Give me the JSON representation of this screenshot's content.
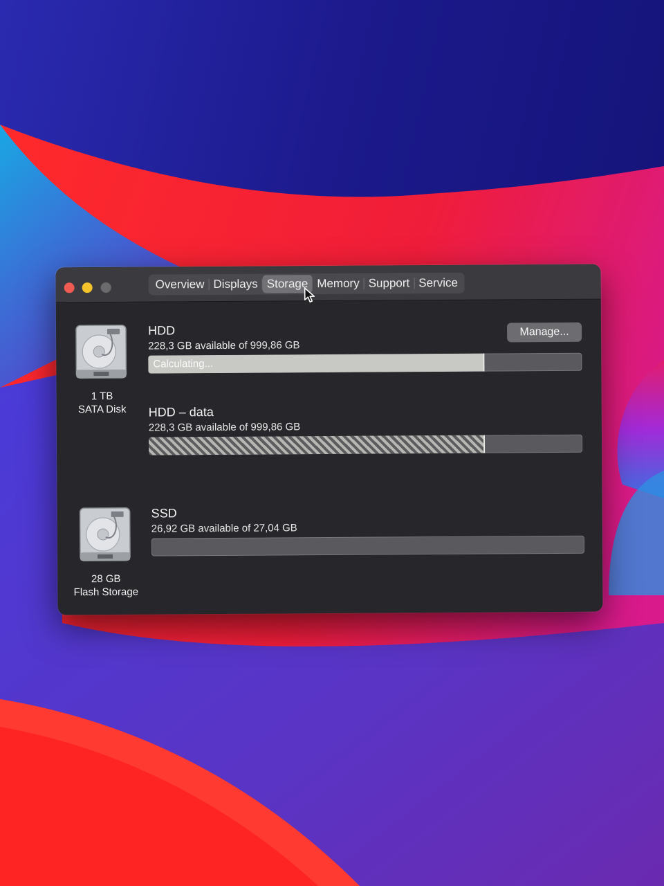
{
  "window": {
    "tabs": [
      {
        "label": "Overview"
      },
      {
        "label": "Displays"
      },
      {
        "label": "Storage",
        "selected": true
      },
      {
        "label": "Memory"
      },
      {
        "label": "Support"
      },
      {
        "label": "Service"
      }
    ]
  },
  "drives": [
    {
      "capacity": "1 TB",
      "type": "SATA Disk",
      "icon": "hard-drive-icon",
      "volumes": [
        {
          "name": "HDD",
          "available": "228,3 GB available of 999,86 GB",
          "used_fraction": 0.772,
          "bar_label": "Calculating..."
        },
        {
          "name": "HDD – data",
          "available": "228,3 GB available of 999,86 GB",
          "used_fraction": 0.772
        }
      ]
    },
    {
      "capacity": "28 GB",
      "type": "Flash Storage",
      "icon": "hard-drive-icon",
      "volumes": [
        {
          "name": "SSD",
          "available": "26,92 GB available of 27,04 GB",
          "used_fraction": 0.0
        }
      ]
    }
  ],
  "manage_button": "Manage...",
  "colors": {
    "window_bg": "#27272b",
    "titlebar_bg": "#3b3b3f",
    "close": "#ef5a52",
    "minimize": "#f4c22a",
    "zoom_disabled": "#6b6b6e"
  }
}
